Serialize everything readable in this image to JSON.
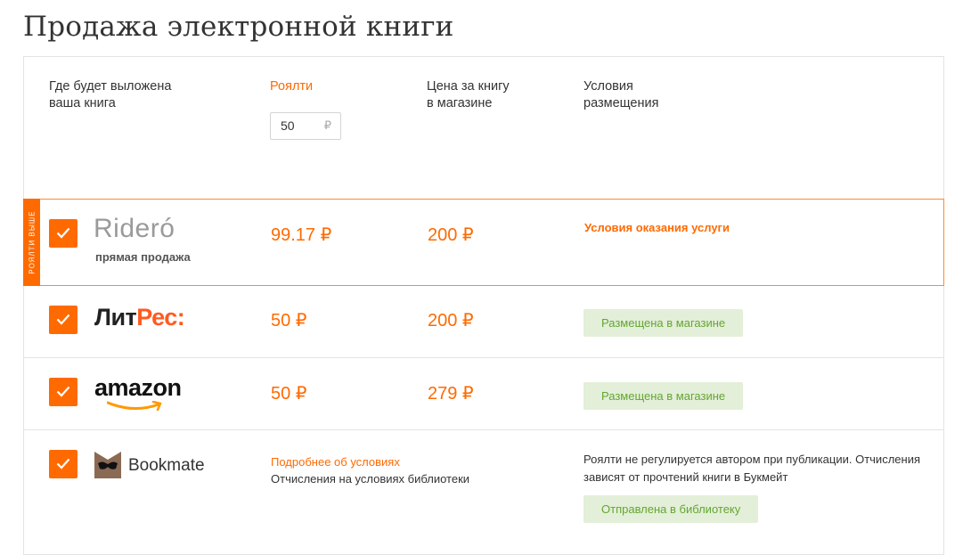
{
  "page": {
    "title": "Продажа электронной книги"
  },
  "header": {
    "where_line1": "Где будет выложена",
    "where_line2": "ваша книга",
    "royalty_label": "Роялти",
    "royalty_value": "50",
    "royalty_currency": "₽",
    "price_line1": "Цена за книгу",
    "price_line2": "в магазине",
    "terms_line1": "Условия",
    "terms_line2": "размещения"
  },
  "rows": [
    {
      "store": "Rideró",
      "store_sub": "прямая продажа",
      "ribbon": "роялти выше",
      "royalty": "99.17 ₽",
      "price": "200 ₽",
      "terms_link": "Условия оказания услуги"
    },
    {
      "store_part1": "Лит",
      "store_part2": "Рес:",
      "royalty": "50 ₽",
      "price": "200 ₽",
      "status": "Размещена в магазине"
    },
    {
      "store": "amazon",
      "royalty": "50 ₽",
      "price": "279 ₽",
      "status": "Размещена в магазине"
    },
    {
      "store": "Bookmate",
      "royalty_link": "Подробнее об условиях",
      "royalty_note": "Отчисления на условиях библиотеки",
      "terms_note_line1": "Роялти не регулируется автором при публикации. Отчисления",
      "terms_note_line2": "зависят от прочтений книги в Букмейт",
      "status": "Отправлена в библиотеку"
    }
  ],
  "colors": {
    "accent": "#ff6a00",
    "badge_bg": "#e3efd8",
    "badge_text": "#64a632"
  },
  "icons": {
    "checkbox": "checkmark-icon",
    "amazon_smile": "amazon-smile-icon",
    "bookmate_mask": "bookmate-mask-icon"
  }
}
